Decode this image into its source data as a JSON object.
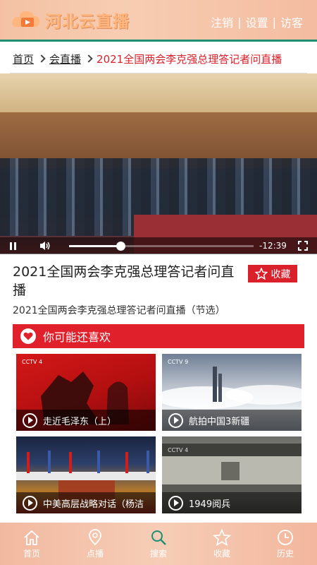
{
  "header": {
    "app_name": "河北云直播",
    "links": [
      "注销",
      "设置",
      "访客"
    ]
  },
  "breadcrumb": {
    "items": [
      "首页",
      "会直播"
    ],
    "current": "2021全国两会李克强总理答记者问直播"
  },
  "player": {
    "time": "-12:39",
    "progress": 0.28
  },
  "video": {
    "title": "2021全国两会李克强总理答记者问直播",
    "subtitle": "2021全国两会李克强总理答记者问直播（节选）",
    "favorite_label": "收藏"
  },
  "recommend": {
    "title": "你可能还喜欢",
    "items": [
      {
        "label": "走近毛泽东（上）"
      },
      {
        "label": "航拍中国3新疆"
      },
      {
        "label": "中美高层战略对话（杨洁"
      },
      {
        "label": "1949阅兵"
      }
    ]
  },
  "nav": {
    "items": [
      {
        "label": "首页",
        "icon": "home-icon"
      },
      {
        "label": "点播",
        "icon": "location-pin-icon"
      },
      {
        "label": "搜索",
        "icon": "search-icon"
      },
      {
        "label": "收藏",
        "icon": "star-icon"
      },
      {
        "label": "历史",
        "icon": "clock-icon"
      }
    ],
    "active_index": 2
  },
  "colors": {
    "accent": "#e0212c",
    "header_line": "#1f8f74",
    "nav_active": "#1f8f74"
  }
}
